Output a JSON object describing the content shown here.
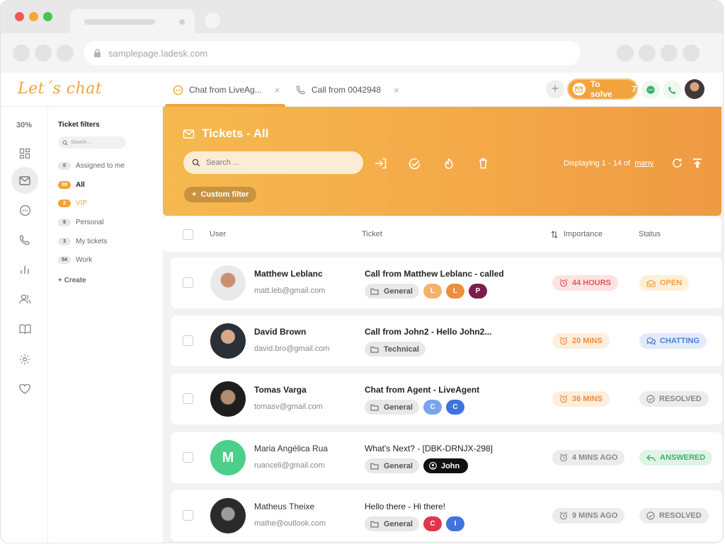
{
  "browser": {
    "url": "samplepage.ladesk.com"
  },
  "app": {
    "logo": "Let´s chat",
    "tabs": [
      {
        "label": "Chat from LiveAg...",
        "close": "×"
      },
      {
        "label": "Call from 0042948",
        "close": "×"
      }
    ],
    "plus": "+",
    "to_solve": {
      "label": "To solve",
      "count": "7"
    }
  },
  "rail": {
    "percent": "30%"
  },
  "filters": {
    "title": "Ticket filters",
    "search_placeholder": "Search ...",
    "items": [
      {
        "count": "0",
        "label": "Assigned to me",
        "highlight": false
      },
      {
        "count": "98",
        "label": "All",
        "highlight": true
      },
      {
        "count": "2",
        "label": "VIP",
        "highlight": true
      },
      {
        "count": "8",
        "label": "Personal",
        "highlight": false
      },
      {
        "count": "3",
        "label": "My tickets",
        "highlight": false
      },
      {
        "count": "54",
        "label": "Work",
        "highlight": false
      }
    ],
    "create": "+ Create"
  },
  "banner": {
    "title": "Tickets - All",
    "search_placeholder": "Search ...",
    "displaying": "Displaying 1 - 14 of",
    "displaying_total": "many",
    "custom_filter": "Custom filter"
  },
  "table": {
    "headers": {
      "user": "User",
      "ticket": "Ticket",
      "importance": "Importance",
      "status": "Status"
    },
    "rows": [
      {
        "name": "Matthew Leblanc",
        "email": "matt.leb@gmail.com",
        "subject": "Call from Matthew Leblanc - called",
        "tag": "General",
        "chips": [
          "L",
          "L",
          "P"
        ],
        "importance": "44 HOURS",
        "status": "OPEN"
      },
      {
        "name": "David Brown",
        "email": "david.bro@gmail.com",
        "subject": "Call from John2 - Hello John2...",
        "tag": "Technical",
        "chips": [],
        "importance": "20 MINS",
        "status": "CHATTING"
      },
      {
        "name": "Tomas Varga",
        "email": "tomasv@gmail.com",
        "subject": "Chat from Agent - LiveAgent",
        "tag": "General",
        "chips": [
          "C",
          "C"
        ],
        "importance": "36 MINS",
        "status": "RESOLVED"
      },
      {
        "name": "Maria Angélica Rua",
        "email": "ruanceli@gmail.com",
        "avatar_letter": "M",
        "subject": "What's Next? - [DBK-DRNJX-298]",
        "tag": "General",
        "owner": "John",
        "importance": "4 MINS AGO",
        "status": "ANSWERED"
      },
      {
        "name": "Matheus Theixe",
        "email": "mathe@outlook.com",
        "subject": "Hello there - Hi there!",
        "tag": "General",
        "chips": [
          "C",
          "I"
        ],
        "importance": "9 MINS AGO",
        "status": "RESOLVED"
      }
    ]
  },
  "colors": {
    "accent": "#f2a33c",
    "banner_start": "#f5b94f",
    "banner_end": "#ef9a43",
    "hours_bg": "#fde3e3",
    "hours_fg": "#e05a5a",
    "mins_bg": "#fdeedd",
    "mins_fg": "#ee8d3b",
    "ago_bg": "#ececec",
    "ago_fg": "#888888",
    "open_bg": "#fdf0d9",
    "open_fg": "#f2a33c",
    "chatting_bg": "#e1ebfb",
    "chatting_fg": "#4a7fd9",
    "resolved_bg": "#ececec",
    "resolved_fg": "#888888",
    "answered_bg": "#dff4e6",
    "answered_fg": "#3cb36b",
    "maria_avatar": "#4ccf8a"
  }
}
